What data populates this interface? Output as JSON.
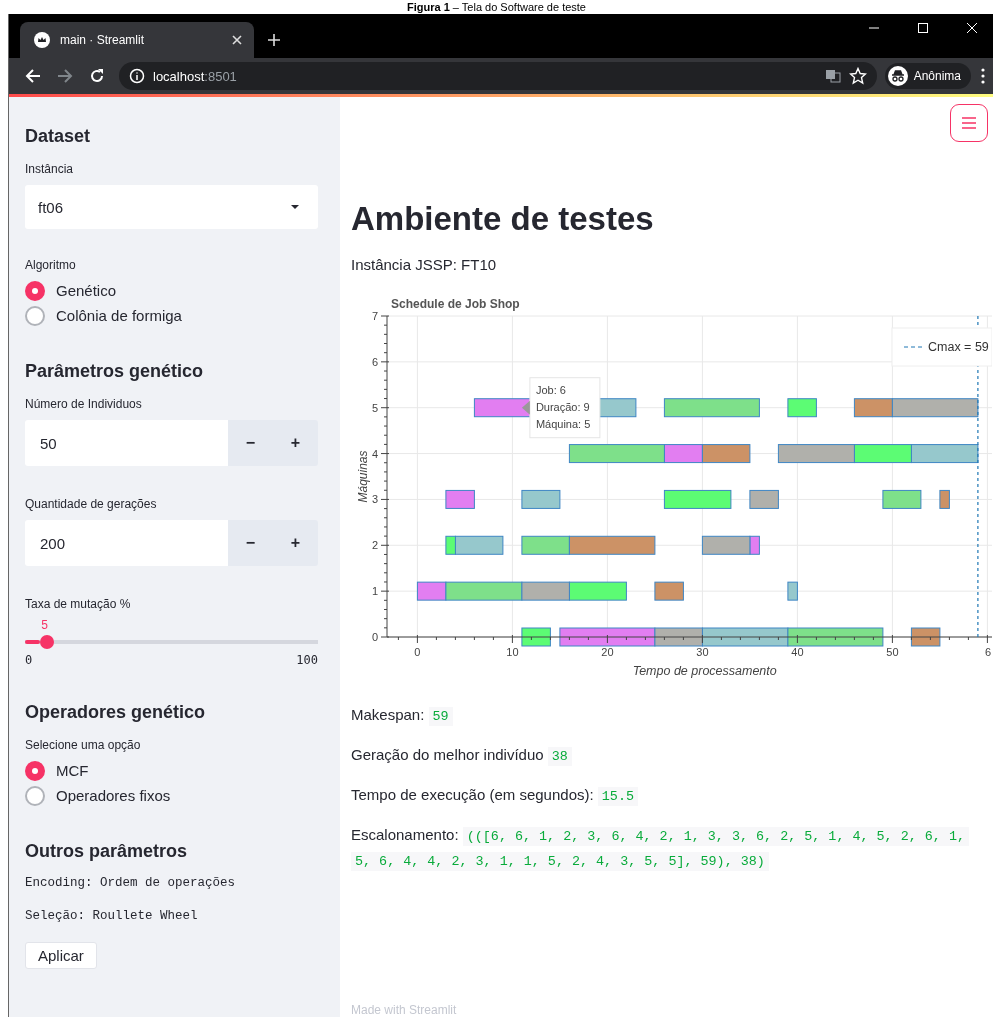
{
  "caption": "**Figura 1** – Tela do Software de teste",
  "browser": {
    "tabs": [
      {
        "title": "main · Streamlit",
        "selected": true
      }
    ],
    "url_host": "localhost",
    "url_port": ":8501",
    "profile": "Anônima"
  },
  "sidebar": {
    "sections": [
      {
        "heading": "Dataset",
        "widgets": [
          {
            "kind": "select",
            "label": "Instância",
            "value": "ft06"
          },
          {
            "kind": "radio",
            "label": "Algoritmo",
            "options": [
              {
                "label": "Genético",
                "selected": true
              },
              {
                "label": "Colônia de formiga",
                "selected": false
              }
            ]
          }
        ]
      },
      {
        "heading": "Parâmetros genético",
        "widgets": [
          {
            "kind": "number",
            "label": "Número de Individuos",
            "value": "50",
            "minus": "−",
            "plus": "+"
          },
          {
            "kind": "number",
            "label": "Quantidade de gerações",
            "value": "200",
            "minus": "−",
            "plus": "+"
          },
          {
            "kind": "slider",
            "label": "Taxa de mutação %",
            "value": "5",
            "min": "0",
            "max": "100",
            "level": 0.05
          }
        ]
      },
      {
        "heading": "Operadores genético",
        "widgets": [
          {
            "kind": "radio",
            "label": "Selecione uma opção",
            "options": [
              {
                "label": "MCF",
                "selected": true
              },
              {
                "label": "Operadores fixos",
                "selected": false
              }
            ]
          }
        ]
      },
      {
        "heading": "Outros parâmetros",
        "widgets": [
          {
            "kind": "code",
            "text": "Encoding: Ordem de operações"
          },
          {
            "kind": "code",
            "text": "Seleção: Roullete Wheel"
          },
          {
            "kind": "button",
            "label": "Aplicar"
          }
        ]
      }
    ]
  },
  "main": {
    "title": "Ambiente de testes",
    "subtitle": "Instância JSSP: FT10",
    "chart": {
      "title": "Schedule de Job Shop",
      "xlabel": "Tempo de processamento",
      "ylabel": "Máquinas",
      "xtick_labels": [
        "0",
        "10",
        "20",
        "30",
        "40",
        "50",
        "6"
      ],
      "ytick_labels": [
        "7",
        "6",
        "5",
        "4",
        "3",
        "2",
        "1",
        "0"
      ],
      "legend": "Cmax = 59",
      "tooltip": [
        "Job: 6",
        "Duração: 9",
        "Máquina: 5"
      ]
    },
    "results": [
      {
        "label": "Makespan:",
        "value": [
          "59"
        ]
      },
      {
        "label": "Geração do melhor indivíduo",
        "value": [
          "38"
        ]
      },
      {
        "label": "Tempo de execução (em segundos):",
        "value": [
          "15.5"
        ]
      },
      {
        "label": "Escalonamento:",
        "value": [
          "(([6, 6, 1, 2, 3, 6, 4, 2, 1, 3, 3, 6, 2, 5, 1, 4, 5, 2, 6, 1,",
          "5, 6, 4, 4, 2, 3, 1, 1, 5, 2, 4, 3, 5, 5], 59), 38)"
        ]
      }
    ],
    "footer": "Made with Streamlit"
  }
}
